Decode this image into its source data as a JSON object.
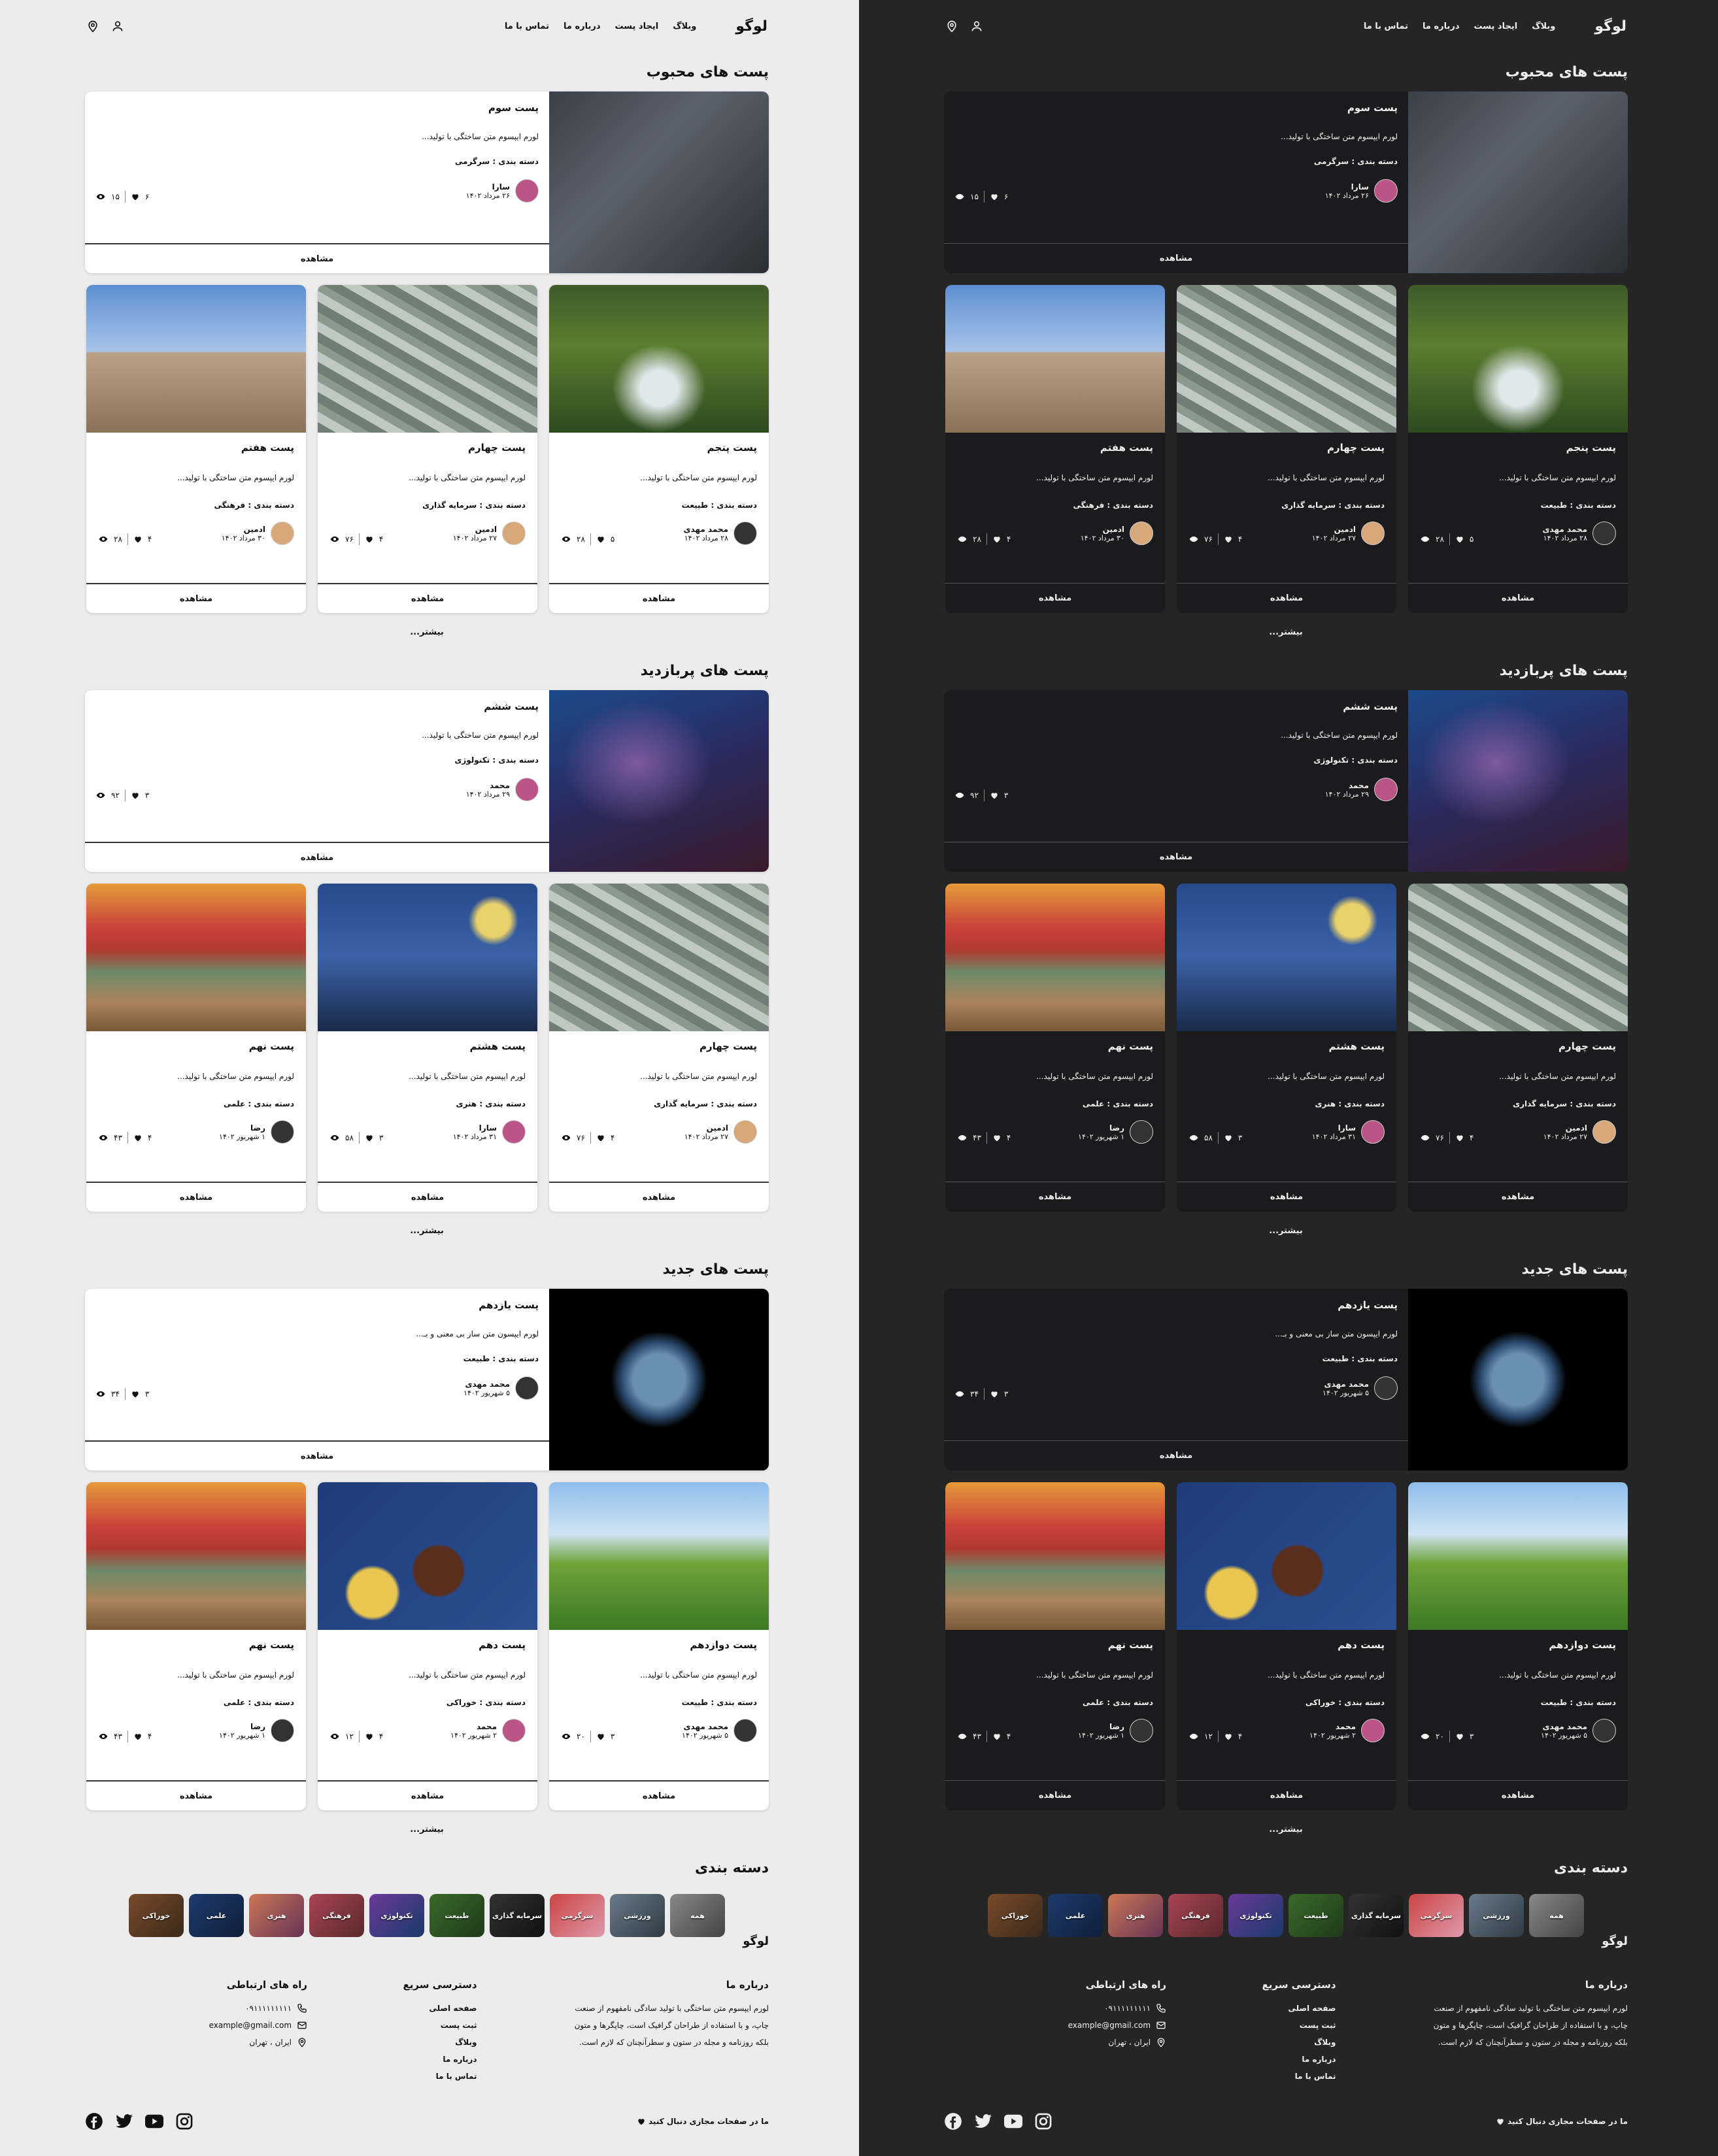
{
  "header": {
    "logo": "لوگو",
    "nav": [
      "وبلاگ",
      "ایجاد پست",
      "درباره ما",
      "تماس با ما"
    ],
    "icons": [
      "location-pin-icon",
      "user-icon"
    ]
  },
  "sections": [
    {
      "title": "پست های محبوب",
      "more": "بیشتر...",
      "featured": {
        "title": "پست سوم",
        "excerpt": "لورم ایپسوم متن ساختگی با تولید...",
        "category": "دسته بندی : سرگرمی",
        "author": "سارا",
        "date": "۲۶ مرداد ۱۴۰۲",
        "likes": "۶",
        "views": "۱۵",
        "image": "retro-game-consoles"
      },
      "cards": [
        {
          "title": "پست پنجم",
          "excerpt": "لورم ایپسوم متن ساختگی با تولید...",
          "category": "دسته بندی : طبیعت",
          "author": "محمد مهدی",
          "date": "۲۸ مرداد ۱۴۰۲",
          "likes": "۵",
          "views": "۲۸",
          "image": "forest-stream"
        },
        {
          "title": "پست چهارم",
          "excerpt": "لورم ایپسوم متن ساختگی با تولید...",
          "category": "دسته بندی : سرمایه گذاری",
          "author": "ادمین",
          "date": "۲۷ مرداد ۱۴۰۲",
          "likes": "۴",
          "views": "۷۶",
          "image": "dollar-bills"
        },
        {
          "title": "پست هفتم",
          "excerpt": "لورم ایپسوم متن ساختگی با تولید...",
          "category": "دسته بندی : فرهنگی",
          "author": "ادمین",
          "date": "۳۰ مرداد ۱۴۰۲",
          "likes": "۴",
          "views": "۲۸",
          "image": "persepolis-ruins"
        }
      ]
    },
    {
      "title": "پست های پربازدید",
      "more": "بیشتر...",
      "featured": {
        "title": "پست ششم",
        "excerpt": "لورم ایپسوم متن ساختگی با تولید...",
        "category": "دسته بندی : تکنولوژی",
        "author": "محمد",
        "date": "۲۹ مرداد ۱۴۰۲",
        "likes": "۳",
        "views": "۹۲",
        "image": "gaming-desk-setup"
      },
      "cards": [
        {
          "title": "پست چهارم",
          "excerpt": "لورم ایپسوم متن ساختگی با تولید...",
          "category": "دسته بندی : سرمایه گذاری",
          "author": "ادمین",
          "date": "۲۷ مرداد ۱۴۰۲",
          "likes": "۴",
          "views": "۷۶",
          "image": "dollar-bills"
        },
        {
          "title": "پست هشتم",
          "excerpt": "لورم ایپسوم متن ساختگی با تولید...",
          "category": "دسته بندی : هنری",
          "author": "سارا",
          "date": "۳۱ مرداد ۱۴۰۲",
          "likes": "۳",
          "views": "۵۸",
          "image": "starry-night-painting"
        },
        {
          "title": "پست نهم",
          "excerpt": "لورم ایپسوم متن ساختگی با تولید...",
          "category": "دسته بندی : علمی",
          "author": "رضا",
          "date": "۱ شهریور ۱۴۰۲",
          "likes": "۴",
          "views": "۴۳",
          "image": "stack-of-books"
        }
      ]
    },
    {
      "title": "پست های جدید",
      "more": "بیشتر...",
      "featured": {
        "title": "پست یازدهم",
        "excerpt": "لورم ایپسون متن ساز بی معنی و بـ...",
        "category": "دسته بندی : طبیعت",
        "author": "محمد مهدی",
        "date": "۵ شهریور ۱۴۰۲",
        "likes": "۳",
        "views": "۳۴",
        "image": "earth-from-space"
      },
      "cards": [
        {
          "title": "پست دوازدهم",
          "excerpt": "لورم ایپسوم متن ساختگی با تولید...",
          "category": "دسته بندی : طبیعت",
          "author": "محمد مهدی",
          "date": "۵ شهریور ۱۴۰۲",
          "likes": "۳",
          "views": "۲۰",
          "image": "green-valley-tree"
        },
        {
          "title": "پست دهم",
          "excerpt": "لورم ایپسوم متن ساختگی با تولید...",
          "category": "دسته بندی : خوراکی",
          "author": "محمد",
          "date": "۲ شهریور ۱۴۰۲",
          "likes": "۴",
          "views": "۱۲",
          "image": "persian-food-dishes"
        },
        {
          "title": "پست نهم",
          "excerpt": "لورم ایپسوم متن ساختگی با تولید...",
          "category": "دسته بندی : علمی",
          "author": "رضا",
          "date": "۱ شهریور ۱۴۰۲",
          "likes": "۴",
          "views": "۴۳",
          "image": "stack-of-books"
        }
      ]
    }
  ],
  "view_label": "مشاهده",
  "categories": {
    "title": "دسته بندی",
    "items": [
      "همه",
      "ورزشی",
      "سرگرمی",
      "سرمایه گذاری",
      "طبیعت",
      "تکنولوژی",
      "فرهنگی",
      "هنری",
      "علمی",
      "خوراکی"
    ]
  },
  "footer": {
    "logo": "لوگو",
    "about_title": "درباره ما",
    "about_text": "لورم ایپسوم متن ساختگی با تولید سادگی نامفهوم از صنعت چاپ، و با استفاده از طراحان گرافیک است، چاپگرها و متون بلکه روزنامه و مجله در ستون و سطرآنچنان که لازم است.",
    "quick_title": "دسترسی سریع",
    "quick_links": [
      "صفحه اصلی",
      "ثبت پست",
      "وبلاگ",
      "درباره ما",
      "تماس با ما"
    ],
    "contact_title": "راه های ارتباطی",
    "phone": "۰۹۱۱۱۱۱۱۱۱۱",
    "email": "example@gmail.com",
    "address": "ایران ، تهران",
    "follow": "ما در صفحات مجازی دنبال کنید",
    "social": [
      "instagram-icon",
      "youtube-icon",
      "twitter-icon",
      "facebook-icon"
    ]
  },
  "colors": {
    "light_bg": "#ececec",
    "dark_bg": "#252526",
    "dark_card": "#1b1b1d"
  }
}
